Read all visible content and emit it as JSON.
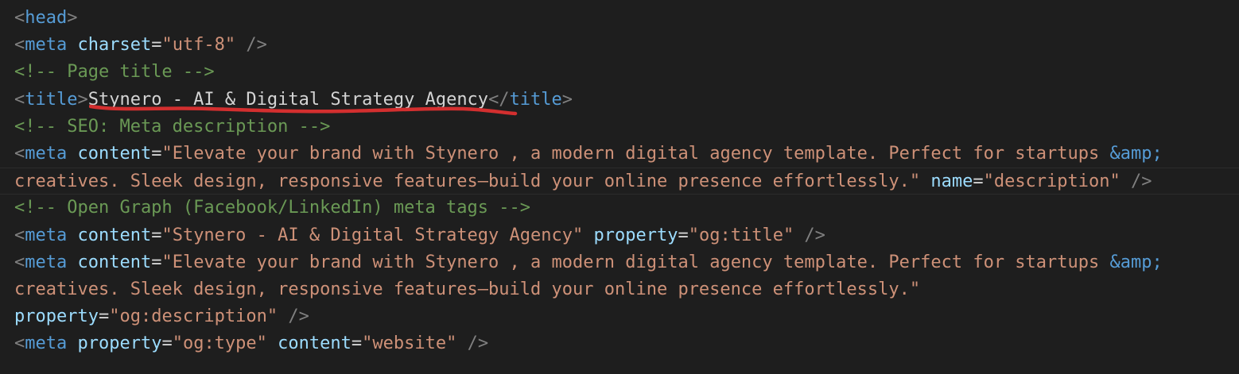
{
  "editor": {
    "lines": {
      "l1": {
        "lt": "<",
        "tag": "head",
        "gt": ">"
      },
      "l2": {
        "lt": "<",
        "tag": "meta",
        "attr": "charset",
        "eq": "=",
        "val": "\"utf-8\"",
        "close": " />"
      },
      "l3": {
        "comment": "<!-- Page title -->"
      },
      "l4": {
        "lt": "<",
        "tag": "title",
        "gt": ">",
        "text": "Stynero - AI & Digital Strategy Agency",
        "lt2": "</",
        "tag2": "title",
        "gt2": ">"
      },
      "l5": {
        "comment": "<!-- SEO: Meta description -->"
      },
      "l6": {
        "lt": "<",
        "tag": "meta",
        "attr": "content",
        "eq": "=",
        "val": "\"Elevate your brand with Stynero , a modern digital agency template. Perfect for startups ",
        "entity": "&amp;"
      },
      "l7": {
        "val": "creatives. Sleek design, responsive features—build your online presence effortlessly.\"",
        "attr": "name",
        "eq": "=",
        "val2": "\"description\"",
        "close": " />"
      },
      "l8": {
        "comment": "<!-- Open Graph (Facebook/LinkedIn) meta tags -->"
      },
      "l9": {
        "lt": "<",
        "tag": "meta",
        "attr": "content",
        "eq": "=",
        "val": "\"Stynero - AI & Digital Strategy Agency\"",
        "attr2": "property",
        "eq2": "=",
        "val2": "\"og:title\"",
        "close": " />"
      },
      "l10": {
        "lt": "<",
        "tag": "meta",
        "attr": "content",
        "eq": "=",
        "val": "\"Elevate your brand with Stynero , a modern digital agency template. Perfect for startups ",
        "entity": "&amp;"
      },
      "l11": {
        "val": "creatives. Sleek design, responsive features—build your online presence effortlessly.\""
      },
      "l12": {
        "attr": "property",
        "eq": "=",
        "val": "\"og:description\"",
        "close": " />"
      },
      "l13": {
        "lt": "<",
        "tag": "meta",
        "attr": "property",
        "eq": "=",
        "val": "\"og:type\"",
        "attr2": "content",
        "eq2": "=",
        "val2": "\"website\"",
        "close": " />"
      }
    },
    "annotation_color": "#d32f2f"
  }
}
